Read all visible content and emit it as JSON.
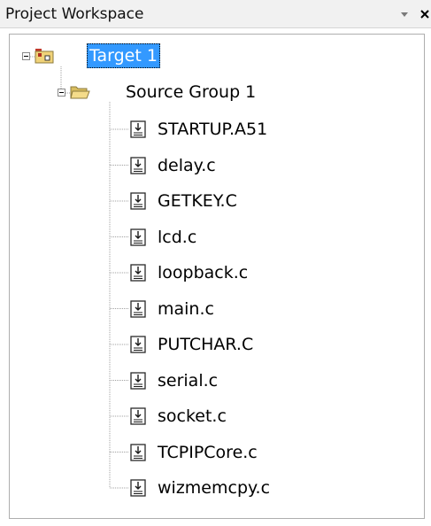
{
  "panel": {
    "title": "Project Workspace",
    "pin_glyph": "▾",
    "close_glyph": "×"
  },
  "tree": {
    "target": {
      "label": "Target 1",
      "selected": true,
      "icon": "target-folder-icon"
    },
    "group": {
      "label": "Source Group 1",
      "icon": "folder-open-icon"
    },
    "files": [
      {
        "label": "STARTUP.A51"
      },
      {
        "label": "delay.c"
      },
      {
        "label": "GETKEY.C"
      },
      {
        "label": "lcd.c"
      },
      {
        "label": "loopback.c"
      },
      {
        "label": "main.c"
      },
      {
        "label": "PUTCHAR.C"
      },
      {
        "label": "serial.c"
      },
      {
        "label": "socket.c"
      },
      {
        "label": "TCPIPCore.c"
      },
      {
        "label": "wizmemcpy.c"
      }
    ]
  },
  "colors": {
    "selection_bg": "#3399ff",
    "selection_text": "#ffffff",
    "folder_yellow": "#f0d278",
    "tree_line": "#a0a0a0"
  }
}
